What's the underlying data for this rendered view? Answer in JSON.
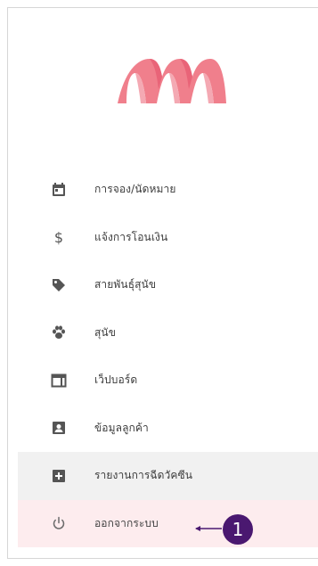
{
  "brand": {
    "colors": [
      "#f07f8c",
      "#e96478",
      "#f4a9b3"
    ]
  },
  "menu": [
    {
      "icon": "calendar-icon",
      "label": "การจอง/นัดหมาย"
    },
    {
      "icon": "dollar-icon",
      "label": "แจ้งการโอนเงิน"
    },
    {
      "icon": "tag-icon",
      "label": "สายพันธุ์สุนัข"
    },
    {
      "icon": "paw-icon",
      "label": "สุนัข"
    },
    {
      "icon": "dashboard-icon",
      "label": "เว็ปบอร์ด"
    },
    {
      "icon": "contact-icon",
      "label": "ข้อมูลลูกค้า"
    },
    {
      "icon": "plus-box-icon",
      "label": "รายงานการฉีดวัคซีน"
    },
    {
      "icon": "power-icon",
      "label": "ออกจากระบบ"
    }
  ],
  "annotation": {
    "number": "1",
    "color": "#4a1870"
  }
}
